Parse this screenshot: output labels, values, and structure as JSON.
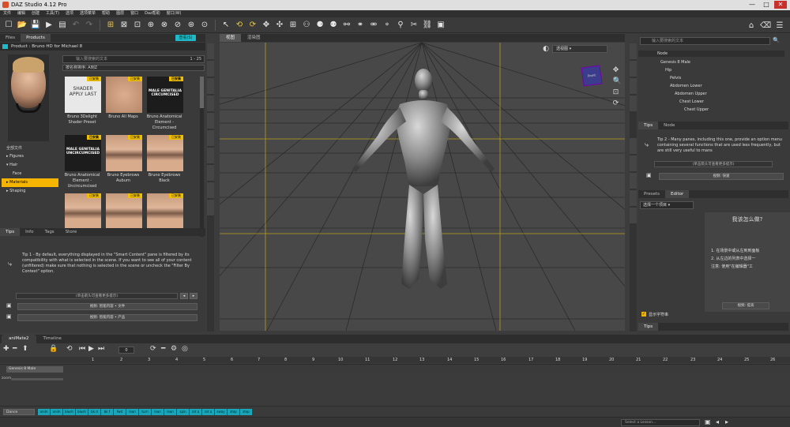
{
  "window": {
    "title": "DAZ Studio 4.12 Pro",
    "controls": [
      "—",
      "□",
      "✕"
    ]
  },
  "menu": [
    "文件",
    "编辑",
    "创建",
    "工具(T)",
    "选项",
    "选项菜单",
    "帮助",
    "图层",
    "窗口",
    "Daz帮助",
    "窗口(W)"
  ],
  "toolbar": {
    "icons": [
      "☐",
      "📂",
      "💾",
      "▶",
      "▤",
      "↶",
      "↷",
      "⊞",
      "⊠",
      "⊡",
      "⊕",
      "⊗",
      "⊘",
      "⊛",
      "⊙",
      "↖",
      "⟲",
      "⟳",
      "✥",
      "✣",
      "⊞",
      "⚇",
      "⚈",
      "⚉",
      "⚯",
      "⚭",
      "⚮",
      "⚬",
      "⚲",
      "✂",
      "⛓",
      "▣"
    ],
    "right_icons": [
      "⌂",
      "⌫",
      "☰"
    ]
  },
  "left_pane": {
    "tabs": [
      "Files",
      "Products"
    ],
    "tab_button": "查看(S)",
    "product_title": "Product : Bruno HD for Michael 8",
    "search_placeholder": "输入要搜索的文本",
    "count": "1 - 25",
    "sort_label": "按名称排序: A到Z",
    "all_files": "全部文件",
    "categories": [
      {
        "label": "▸ Figures",
        "type": "normal"
      },
      {
        "label": "▾ Hair",
        "type": "normal"
      },
      {
        "label": "Face",
        "type": "sub"
      },
      {
        "label": "▸ Materials",
        "type": "sel"
      },
      {
        "label": "▸ Shaping",
        "type": "normal"
      }
    ],
    "items": [
      {
        "label": "Bruno 3Delight Shader Preset",
        "thumb": "white",
        "thumb_text": "SHADER\nAPPLY LAST",
        "badge": "已安装"
      },
      {
        "label": "Bruno All Maps",
        "thumb": "skin",
        "thumb_text": "",
        "badge": "已安装"
      },
      {
        "label": "Bruno Anatomical Element - Circumcised",
        "thumb": "dark",
        "thumb_text": "MALE GENITALIA CIRCUMCISED",
        "badge": "已安装"
      },
      {
        "label": "Bruno Anatomical Element - Uncircumcised",
        "thumb": "dark",
        "thumb_text": "MALE GENITALIA UNCIRCUMCISED",
        "badge": "已安装"
      },
      {
        "label": "Bruno Eyebrows Auburn",
        "thumb": "eye",
        "thumb_text": "",
        "badge": "已安装"
      },
      {
        "label": "Bruno Eyebrows Black",
        "thumb": "eye",
        "thumb_text": "",
        "badge": "已安装"
      },
      {
        "label": "",
        "thumb": "eye",
        "thumb_text": "",
        "badge": "已安装"
      },
      {
        "label": "",
        "thumb": "eye",
        "thumb_text": "",
        "badge": "已安装"
      },
      {
        "label": "",
        "thumb": "eye",
        "thumb_text": "",
        "badge": "已安装"
      }
    ],
    "bottom_tabs": [
      "Tips",
      "Info",
      "Tags",
      "Store"
    ],
    "tip": "Tip 1 - By default, everything displayed in the \"Smart Content\" pane is filtered by its compatibility with what is selected in the scene. If you want to see all of your content (unfiltered) make sure that nothing is selected in the scene or uncheck the \"Filter By Context\" option.",
    "hint": "(单击箭头可查看更多提示)",
    "video_buttons": [
      "视频: 智能内容 • 文件",
      "视频: 智能内容 • 产品"
    ]
  },
  "viewport": {
    "tabs": [
      "视图",
      "渲染图"
    ],
    "camera": "透视图",
    "cube_label": "Front"
  },
  "right_pane": {
    "search_placeholder": "输入要搜索的文本",
    "node_header": "Node",
    "nodes": [
      {
        "label": "Genesis 8 Male",
        "indent": 0
      },
      {
        "label": "Hip",
        "indent": 1
      },
      {
        "label": "Pelvis",
        "indent": 2
      },
      {
        "label": "Abdomen Lower",
        "indent": 2
      },
      {
        "label": "Abdomen Upper",
        "indent": 3
      },
      {
        "label": "Chest Lower",
        "indent": 4
      },
      {
        "label": "Chest Upper",
        "indent": 5
      }
    ],
    "tabs_mid": [
      "Tips",
      "Node"
    ],
    "tip": "Tip 2 - Many panes, including this one, provide an option menu containing several functions that are used less frequently, but are still very useful to mans",
    "hint": "(单击箭头可查看更多提示)",
    "video_button": "视频: 快速",
    "tabs_lower": [
      "Presets",
      "Editor"
    ],
    "lesson_dropdown": "选择一个项目",
    "lesson_title": "我该怎么做?",
    "lesson_steps": [
      "1. 在场景中或从左到到面板",
      "2. 从左边的列表中选择一",
      "注意: 使用\"在编辑器\"工"
    ],
    "checkbox_label": "显示字符串",
    "lesson_video": "视频: 提高",
    "bottom_tab": "Tips"
  },
  "timeline": {
    "tabs": [
      "aniMate2",
      "Timeline"
    ],
    "frame_value": "0",
    "ticks": [
      "1",
      "2",
      "3",
      "4",
      "5",
      "6",
      "7",
      "8",
      "9",
      "10",
      "11",
      "12",
      "13",
      "14",
      "15",
      "16",
      "17",
      "18",
      "19",
      "20",
      "21",
      "22",
      "23",
      "24",
      "25",
      "26"
    ],
    "track_label": "Genesis 8 Male",
    "zoom_label": "zoom",
    "dance_button": "Dance",
    "chips": [
      "anim",
      "anim",
      "blush",
      "blush",
      "bk d",
      "bk f",
      "fwd",
      "lean",
      "turn",
      "lean",
      "lean",
      "spin",
      "rot a",
      "rot a",
      "sway",
      "step",
      "step"
    ],
    "lesson_select": "Select a Lesson..."
  }
}
